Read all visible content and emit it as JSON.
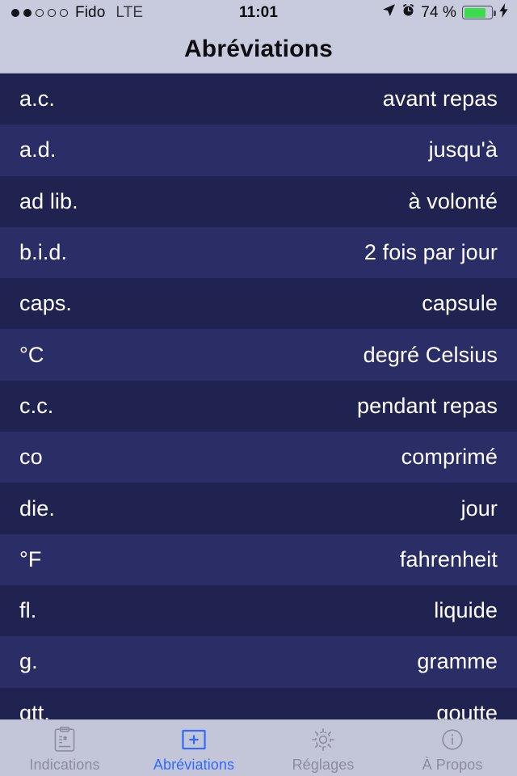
{
  "status_bar": {
    "signal_dots_filled": 2,
    "signal_dots_total": 5,
    "carrier": "Fido",
    "radio": "LTE",
    "time": "11:01",
    "battery_percent_label": "74 %",
    "battery_level": 74,
    "icons": [
      "location-arrow-icon",
      "alarm-clock-icon",
      "battery-icon",
      "charging-bolt-icon"
    ]
  },
  "nav": {
    "title": "Abréviations"
  },
  "list": {
    "rows": [
      {
        "abbr": "a.c.",
        "meaning": "avant repas"
      },
      {
        "abbr": "a.d.",
        "meaning": "jusqu'à"
      },
      {
        "abbr": "ad lib.",
        "meaning": "à volonté"
      },
      {
        "abbr": "b.i.d.",
        "meaning": "2 fois par jour"
      },
      {
        "abbr": "caps.",
        "meaning": "capsule"
      },
      {
        "abbr": "°C",
        "meaning": "degré Celsius"
      },
      {
        "abbr": "c.c.",
        "meaning": "pendant repas"
      },
      {
        "abbr": "co",
        "meaning": "comprimé"
      },
      {
        "abbr": "die.",
        "meaning": "jour"
      },
      {
        "abbr": "°F",
        "meaning": "fahrenheit"
      },
      {
        "abbr": "fl.",
        "meaning": "liquide"
      },
      {
        "abbr": "g.",
        "meaning": "gramme"
      },
      {
        "abbr": "gtt.",
        "meaning": "goutte"
      }
    ]
  },
  "tab_bar": {
    "active_index": 1,
    "tabs": [
      {
        "label": "Indications",
        "icon": "clipboard-icon"
      },
      {
        "label": "Abréviations",
        "icon": "plus-square-icon"
      },
      {
        "label": "Réglages",
        "icon": "gear-icon"
      },
      {
        "label": "À Propos",
        "icon": "info-circle-icon"
      }
    ]
  },
  "colors": {
    "row_dark": "#20234f",
    "row_light": "#2b2e66",
    "chrome": "#c8cadd",
    "accent": "#2f6bff",
    "battery_green": "#3ddb4f"
  }
}
